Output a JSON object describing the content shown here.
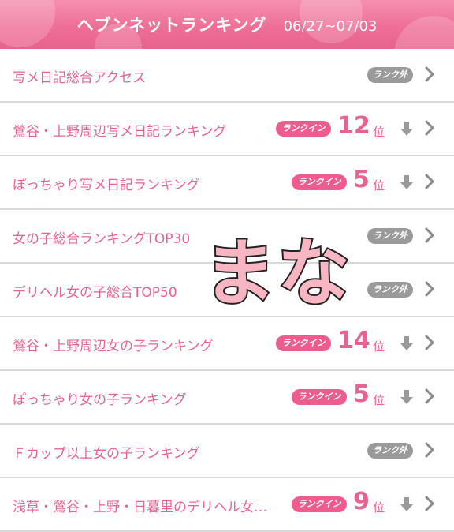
{
  "header": {
    "title": "ヘブンネットランキング",
    "date_range": "06/27~07/03"
  },
  "badges": {
    "out": "ランク外",
    "in": "ランクイン",
    "rank_unit": "位"
  },
  "overlay": {
    "text": "まな",
    "color": "#f8b6c3"
  },
  "colors": {
    "accent": "#e9638f",
    "header_bg": "#ee6f98",
    "badge_in": "#ee5c8e",
    "badge_out": "#9a9a9a"
  },
  "rows": [
    {
      "title": "写メ日記総合アクセス",
      "status": "out"
    },
    {
      "title": "鶯谷・上野周辺写メ日記ランキング",
      "status": "in",
      "rank": "12",
      "trend": "down"
    },
    {
      "title": "ぽっちゃり写メ日記ランキング",
      "status": "in",
      "rank": "5",
      "trend": "down"
    },
    {
      "title": "女の子総合ランキングTOP30",
      "status": "out"
    },
    {
      "title": "デリヘル女の子総合TOP50",
      "status": "out"
    },
    {
      "title": "鶯谷・上野周辺女の子ランキング",
      "status": "in",
      "rank": "14",
      "trend": "down"
    },
    {
      "title": "ぽっちゃり女の子ランキング",
      "status": "in",
      "rank": "5",
      "trend": "down"
    },
    {
      "title": "Ｆカップ以上女の子ランキング",
      "status": "out"
    },
    {
      "title": "浅草・鶯谷・上野・日暮里のデリヘル女…",
      "status": "in",
      "rank": "9",
      "trend": "down"
    }
  ]
}
